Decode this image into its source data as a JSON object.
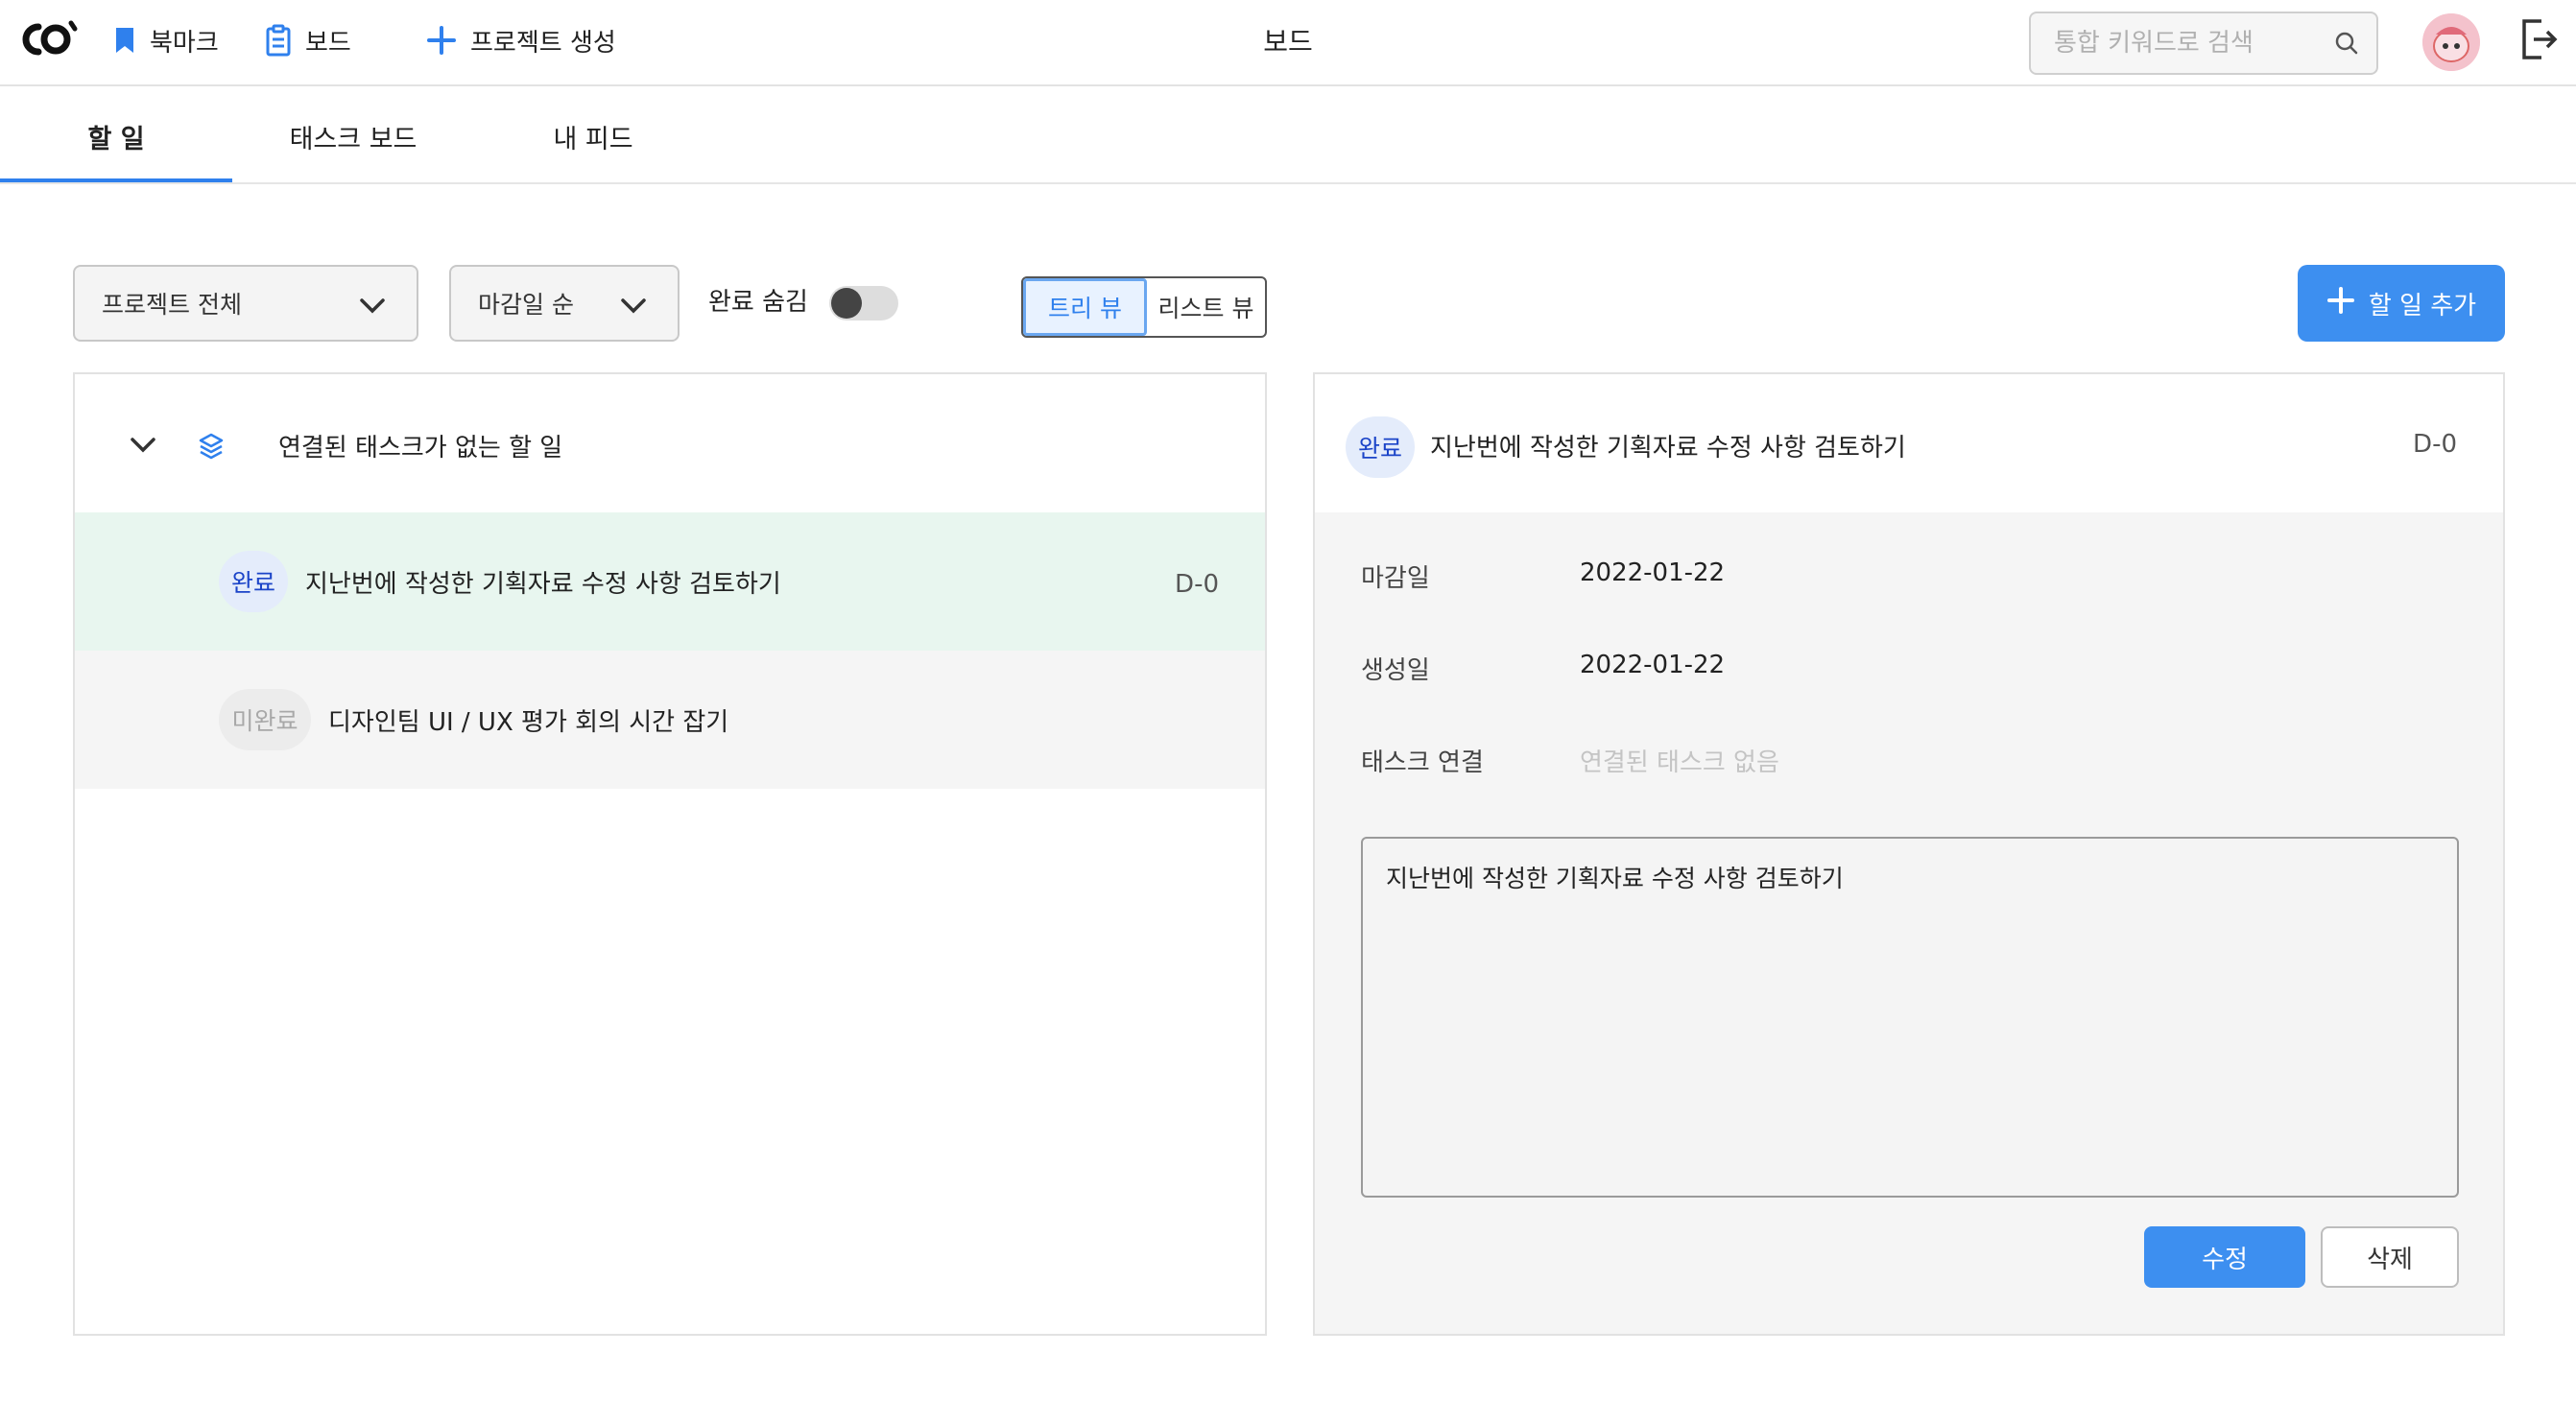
{
  "header": {
    "logo_text": "co",
    "nav": {
      "bookmark_label": "북마크",
      "board_label": "보드",
      "create_project_label": "프로젝트 생성"
    },
    "title": "보드",
    "search_placeholder": "통합 키워드로 검색",
    "accent_color": "#2f80ed"
  },
  "tabs": [
    {
      "label": "할 일",
      "active": true
    },
    {
      "label": "태스크 보드",
      "active": false
    },
    {
      "label": "내 피드",
      "active": false
    }
  ],
  "filters": {
    "project_select": "프로젝트 전체",
    "sort_select": "마감일 순",
    "hide_done_label": "완료 숨김",
    "hide_done_on": false,
    "view_options": [
      "트리 뷰",
      "리스트 뷰"
    ],
    "active_view": "트리 뷰",
    "add_button_label": "할 일 추가"
  },
  "todo_list": {
    "group_title": "연결된 태스크가 없는 할 일",
    "items": [
      {
        "status": "완료",
        "title": "지난번에 작성한 기획자료 수정 사항 검토하기",
        "dday": "D-0",
        "selected": true
      },
      {
        "status": "미완료",
        "title": "디자인팀 UI / UX 평가 회의 시간 잡기",
        "dday": "",
        "selected": false
      }
    ]
  },
  "detail": {
    "status": "완료",
    "title": "지난번에 작성한 기획자료 수정 사항 검토하기",
    "dday": "D-0",
    "fields": [
      {
        "label": "마감일",
        "value": "2022-01-22"
      },
      {
        "label": "생성일",
        "value": "2022-01-22"
      },
      {
        "label": "태스크 연결",
        "value": "연결된 태스크 없음"
      }
    ],
    "memo": "지난번에 작성한 기획자료 수정 사항 검토하기",
    "edit_label": "수정",
    "delete_label": "삭제"
  }
}
